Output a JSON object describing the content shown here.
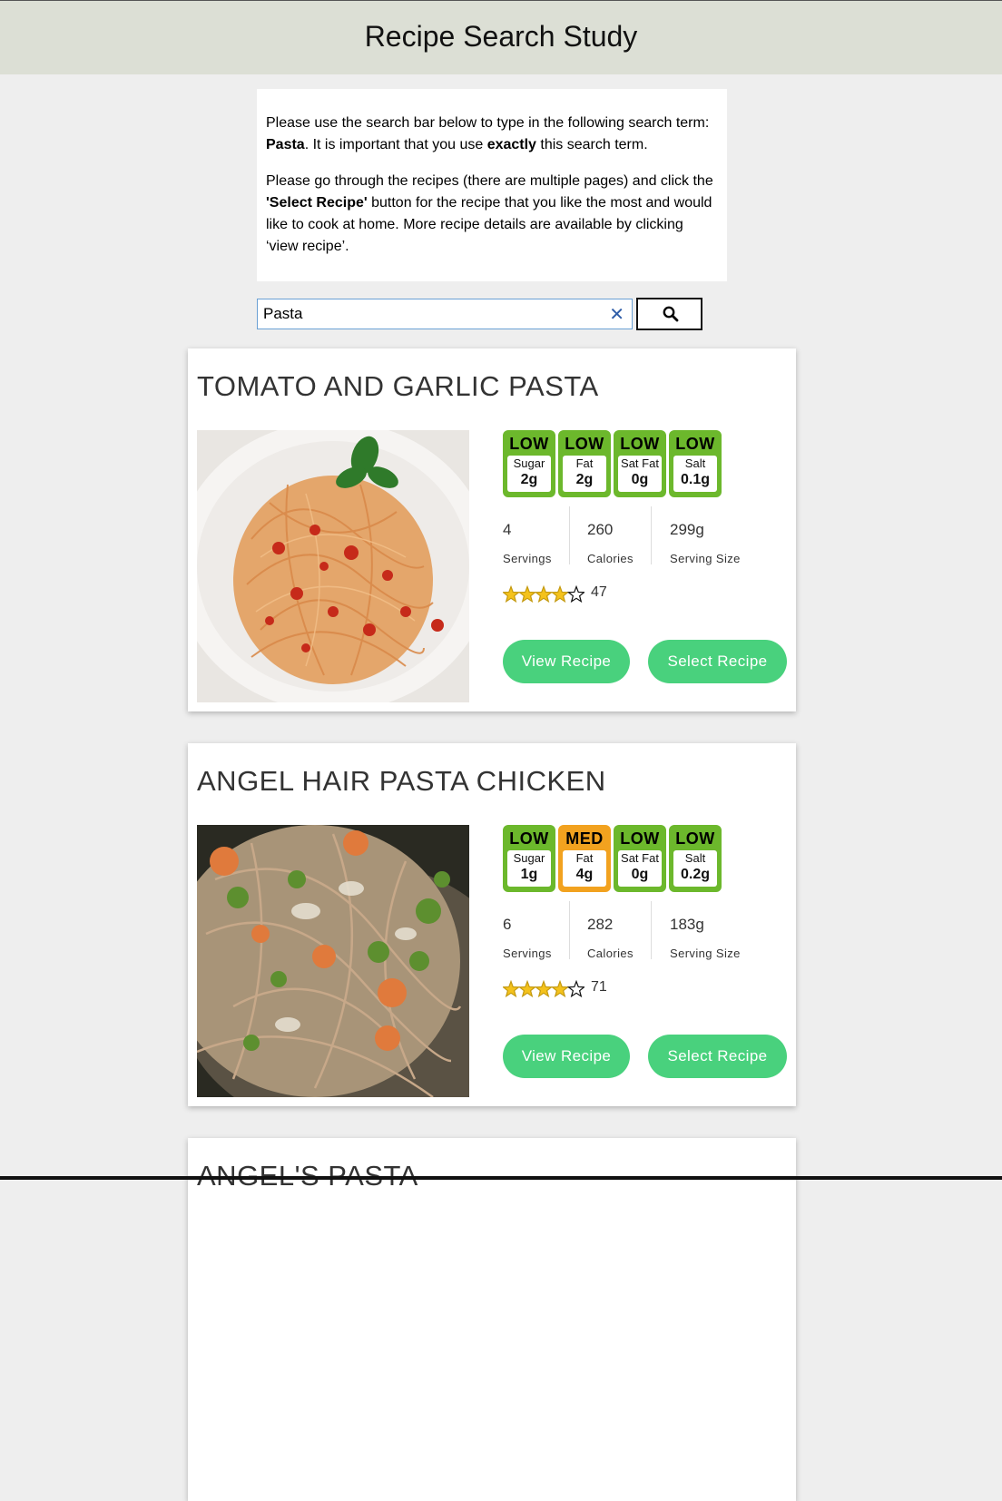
{
  "header": {
    "title": "Recipe Search Study"
  },
  "instructions": {
    "p1_prefix": "Please use the search bar below to type in the following search term: ",
    "p1_term": "Pasta",
    "p1_mid": ". It is important that you use ",
    "p1_emph": "exactly",
    "p1_suffix": " this search term.",
    "p2_prefix": "Please go through the recipes (there are multiple pages) and click the ",
    "p2_emph": "'Select Recipe'",
    "p2_suffix": " button for the recipe that you like the most and would like to cook at home. More recipe details are available by clicking ‘view recipe’."
  },
  "search": {
    "value": "Pasta",
    "clear_icon": "close-icon",
    "button_icon": "search-icon"
  },
  "colors": {
    "low": "#6cb82c",
    "med": "#f2a21f",
    "button": "#49d17d",
    "header": "#dcdfd5"
  },
  "recipes": [
    {
      "title": "TOMATO AND GARLIC PASTA",
      "labels": [
        {
          "level": "LOW",
          "name": "Sugar",
          "value": "2g"
        },
        {
          "level": "LOW",
          "name": "Fat",
          "value": "2g"
        },
        {
          "level": "LOW",
          "name": "Sat Fat",
          "value": "0g"
        },
        {
          "level": "LOW",
          "name": "Salt",
          "value": "0.1g"
        }
      ],
      "servings": "4",
      "servings_label": "Servings",
      "calories": "260",
      "calories_label": "Calories",
      "serving_size": "299g",
      "serving_size_label": "Serving Size",
      "rating": 4,
      "rating_max": 5,
      "rating_count": "47",
      "view_label": "View Recipe",
      "select_label": "Select Recipe"
    },
    {
      "title": "ANGEL HAIR PASTA CHICKEN",
      "labels": [
        {
          "level": "LOW",
          "name": "Sugar",
          "value": "1g"
        },
        {
          "level": "MED",
          "name": "Fat",
          "value": "4g"
        },
        {
          "level": "LOW",
          "name": "Sat Fat",
          "value": "0g"
        },
        {
          "level": "LOW",
          "name": "Salt",
          "value": "0.2g"
        }
      ],
      "servings": "6",
      "servings_label": "Servings",
      "calories": "282",
      "calories_label": "Calories",
      "serving_size": "183g",
      "serving_size_label": "Serving Size",
      "rating": 4,
      "rating_max": 5,
      "rating_count": "71",
      "view_label": "View Recipe",
      "select_label": "Select Recipe"
    },
    {
      "title": "ANGEL'S PASTA"
    }
  ]
}
